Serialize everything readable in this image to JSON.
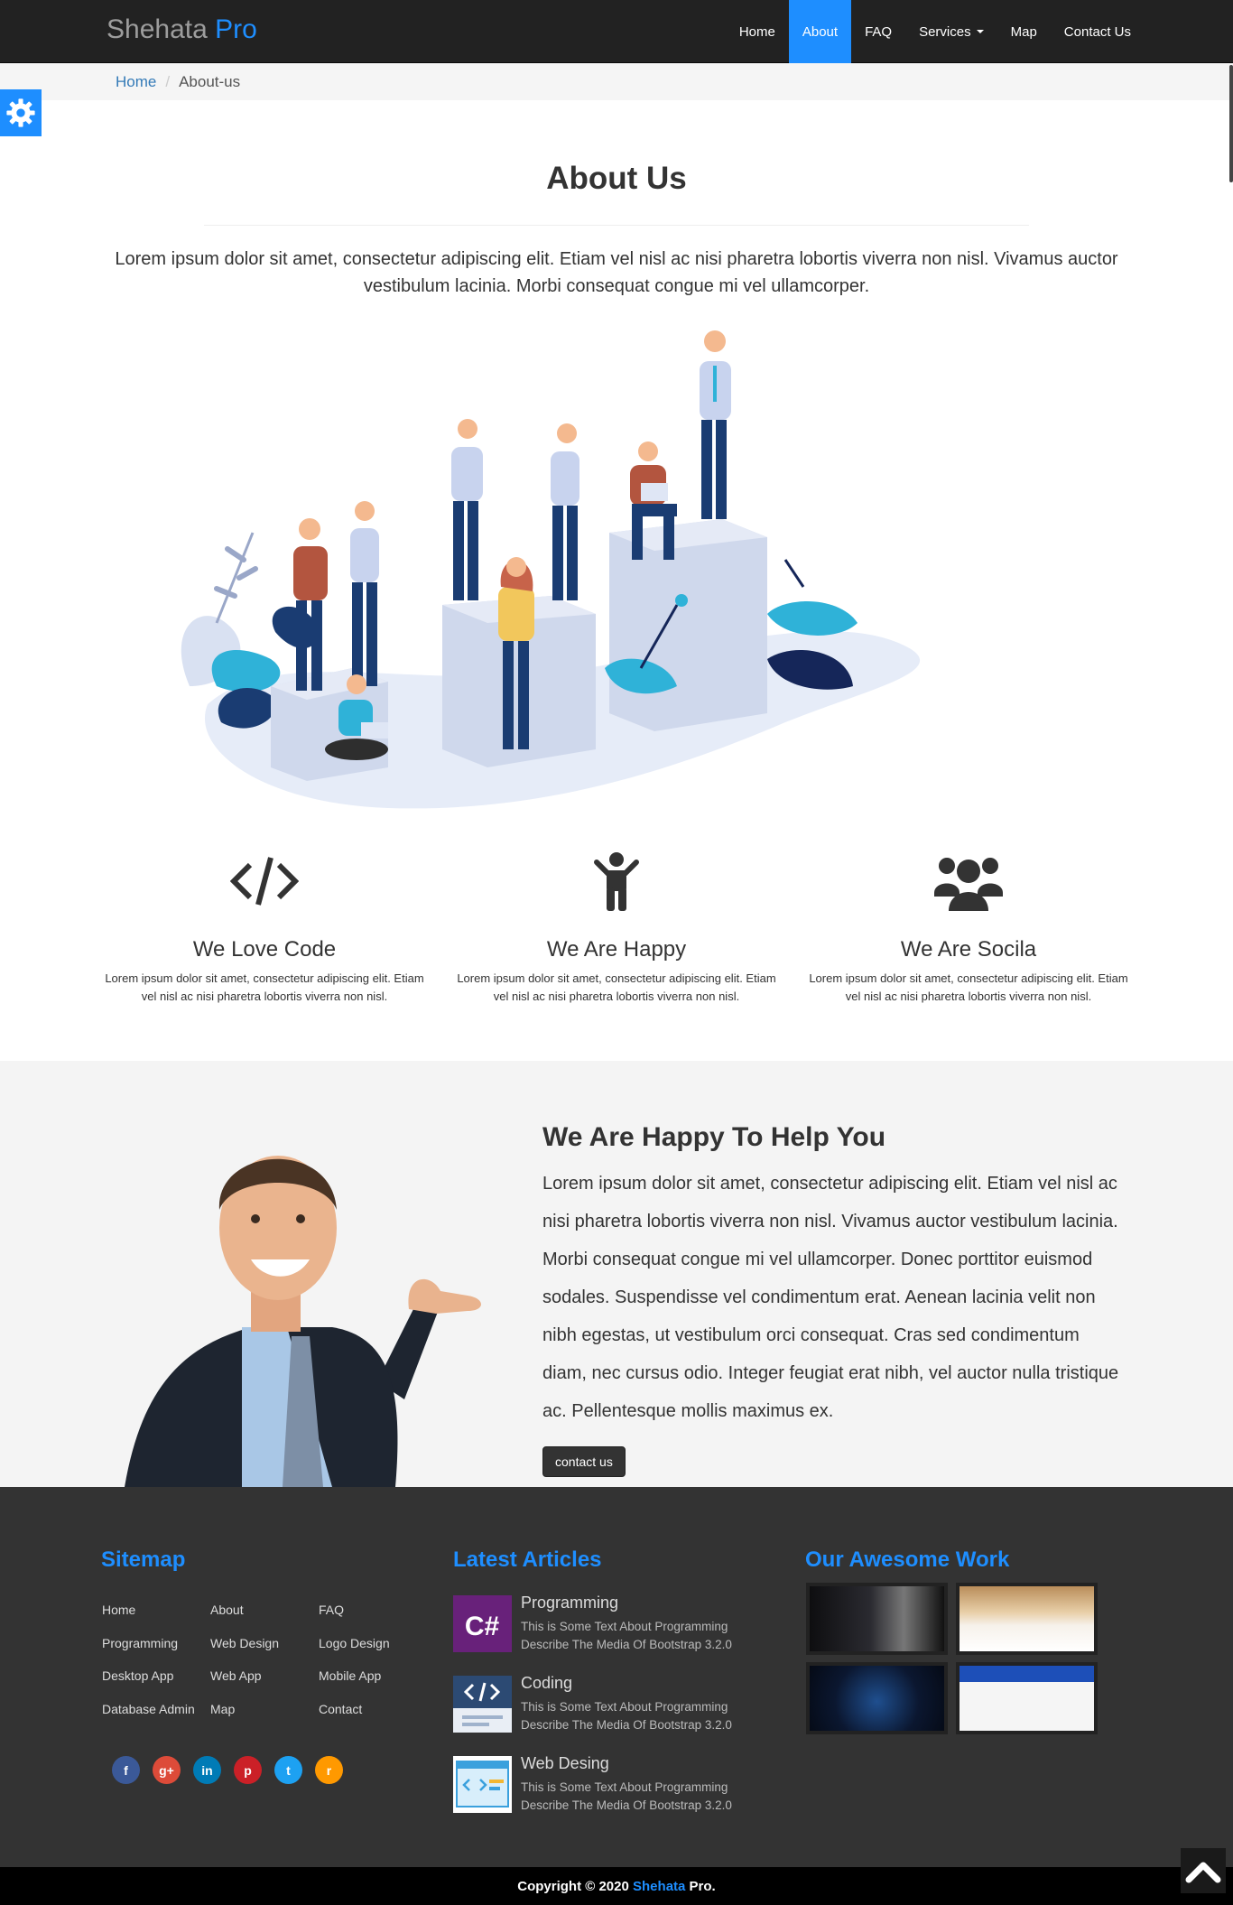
{
  "nav": {
    "brand_main": "Shehata",
    "brand_accent": "Pro",
    "items": [
      {
        "label": "Home",
        "active": false
      },
      {
        "label": "About",
        "active": true
      },
      {
        "label": "FAQ",
        "active": false
      },
      {
        "label": "Services",
        "active": false,
        "dropdown": true
      },
      {
        "label": "Map",
        "active": false
      },
      {
        "label": "Contact Us",
        "active": false
      }
    ]
  },
  "breadcrumb": {
    "home": "Home",
    "separator": "/",
    "current": "About-us"
  },
  "settings_icon": "gear-icon",
  "about": {
    "title": "About Us",
    "text": "Lorem ipsum dolor sit amet, consectetur adipiscing elit. Etiam vel nisl ac nisi pharetra lobortis viverra non nisl. Vivamus auctor vestibulum lacinia. Morbi consequat congue mi vel ullamcorper."
  },
  "features": [
    {
      "icon": "code-icon",
      "title": "We Love Code",
      "text": "Lorem ipsum dolor sit amet, consectetur adipiscing elit. Etiam vel nisl ac nisi pharetra lobortis viverra non nisl."
    },
    {
      "icon": "child-icon",
      "title": "We Are Happy",
      "text": "Lorem ipsum dolor sit amet, consectetur adipiscing elit. Etiam vel nisl ac nisi pharetra lobortis viverra non nisl."
    },
    {
      "icon": "users-icon",
      "title": "We Are Socila",
      "text": "Lorem ipsum dolor sit amet, consectetur adipiscing elit. Etiam vel nisl ac nisi pharetra lobortis viverra non nisl."
    }
  ],
  "help": {
    "title": "We Are Happy To Help You",
    "text": "Lorem ipsum dolor sit amet, consectetur adipiscing elit. Etiam vel nisl ac nisi pharetra lobortis viverra non nisl. Vivamus auctor vestibulum lacinia. Morbi consequat congue mi vel ullamcorper. Donec porttitor euismod sodales. Suspendisse vel condimentum erat. Aenean lacinia velit non nibh egestas, ut vestibulum orci consequat. Cras sed condimentum diam, nec cursus odio. Integer feugiat erat nibh, vel auctor nulla tristique ac. Pellentesque mollis maximus ex.",
    "button": "contact us"
  },
  "footer": {
    "sitemap_title": "Sitemap",
    "sitemap_links": [
      "Home",
      "About",
      "FAQ",
      "Programming",
      "Web Design",
      "Logo Design",
      "Desktop App",
      "Web App",
      "Mobile App",
      "Database Admin",
      "Map",
      "Contact"
    ],
    "social": [
      {
        "icon": "facebook-icon",
        "glyph": "f",
        "color": "#3b5998"
      },
      {
        "icon": "google-plus-icon",
        "glyph": "g+",
        "color": "#dd4b39"
      },
      {
        "icon": "linkedin-icon",
        "glyph": "in",
        "color": "#007bb6"
      },
      {
        "icon": "pinterest-icon",
        "glyph": "p",
        "color": "#cb2027"
      },
      {
        "icon": "twitter-icon",
        "glyph": "t",
        "color": "#1da1f2"
      },
      {
        "icon": "rss-icon",
        "glyph": "r",
        "color": "#ff9900"
      }
    ],
    "articles_title": "Latest Articles",
    "articles": [
      {
        "title": "Programming",
        "desc": "This is Some Text About Programming Describe The Media Of Bootstrap 3.2.0",
        "thumb": "csharp-thumb"
      },
      {
        "title": "Coding",
        "desc": "This is Some Text About Programming Describe The Media Of Bootstrap 3.2.0",
        "thumb": "coding-thumb"
      },
      {
        "title": "Web Desing",
        "desc": "This is Some Text About Programming Describe The Media Of Bootstrap 3.2.0",
        "thumb": "webdesign-thumb"
      }
    ],
    "work_title": "Our Awesome Work",
    "csharp_glyph": "C#",
    "copyright_prefix": "Copyright © 2020",
    "copyright_brand": "Shehata",
    "copyright_suffix": "Pro."
  }
}
